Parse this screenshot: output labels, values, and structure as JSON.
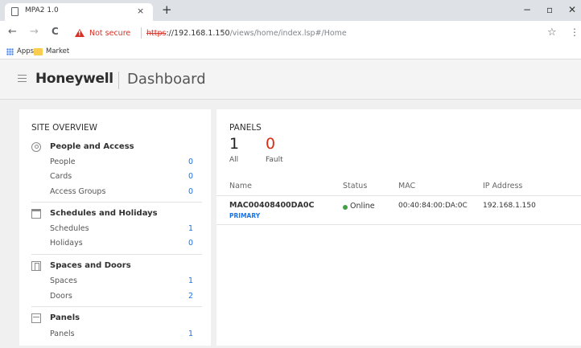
{
  "browser": {
    "tab_title": "MPA2 1.0",
    "tab_close": "×",
    "new_tab": "+",
    "minimize": "−",
    "maximize": "▫",
    "close": "✕",
    "back": "←",
    "forward": "→",
    "reload": "C",
    "not_secure": "Not secure",
    "url_scheme": "https",
    "url_host": "://192.168.1.150",
    "url_path": "/views/home/index.lsp#/Home",
    "star": "☆",
    "menu": "⋮",
    "bookmarks": {
      "apps": "Apps",
      "market": "Market"
    }
  },
  "header": {
    "brand": "Honeywell",
    "title": "Dashboard"
  },
  "site_overview": {
    "title": "SITE OVERVIEW",
    "sections": [
      {
        "title": "People and Access",
        "icon": "person-circle-icon",
        "rows": [
          {
            "label": "People",
            "count": "0"
          },
          {
            "label": "Cards",
            "count": "0"
          },
          {
            "label": "Access Groups",
            "count": "0"
          }
        ]
      },
      {
        "title": "Schedules and Holidays",
        "icon": "calendar-icon",
        "rows": [
          {
            "label": "Schedules",
            "count": "1"
          },
          {
            "label": "Holidays",
            "count": "0"
          }
        ]
      },
      {
        "title": "Spaces and Doors",
        "icon": "door-icon",
        "rows": [
          {
            "label": "Spaces",
            "count": "1"
          },
          {
            "label": "Doors",
            "count": "2"
          }
        ]
      },
      {
        "title": "Panels",
        "icon": "panel-icon",
        "rows": [
          {
            "label": "Panels",
            "count": "1"
          }
        ]
      }
    ]
  },
  "panels": {
    "title": "PANELS",
    "all_count": "1",
    "all_label": "All",
    "fault_count": "0",
    "fault_label": "Fault",
    "columns": [
      "Name",
      "Status",
      "MAC",
      "IP Address"
    ],
    "rows": [
      {
        "name": "MAC00408400DA0C",
        "tag": "PRIMARY",
        "status": "Online",
        "mac": "00:40:84:00:DA:0C",
        "ip": "192.168.1.150"
      }
    ]
  },
  "colors": {
    "link": "#1a73e8",
    "fault": "#d82d12",
    "online": "#43a047",
    "warning": "#d93025"
  }
}
